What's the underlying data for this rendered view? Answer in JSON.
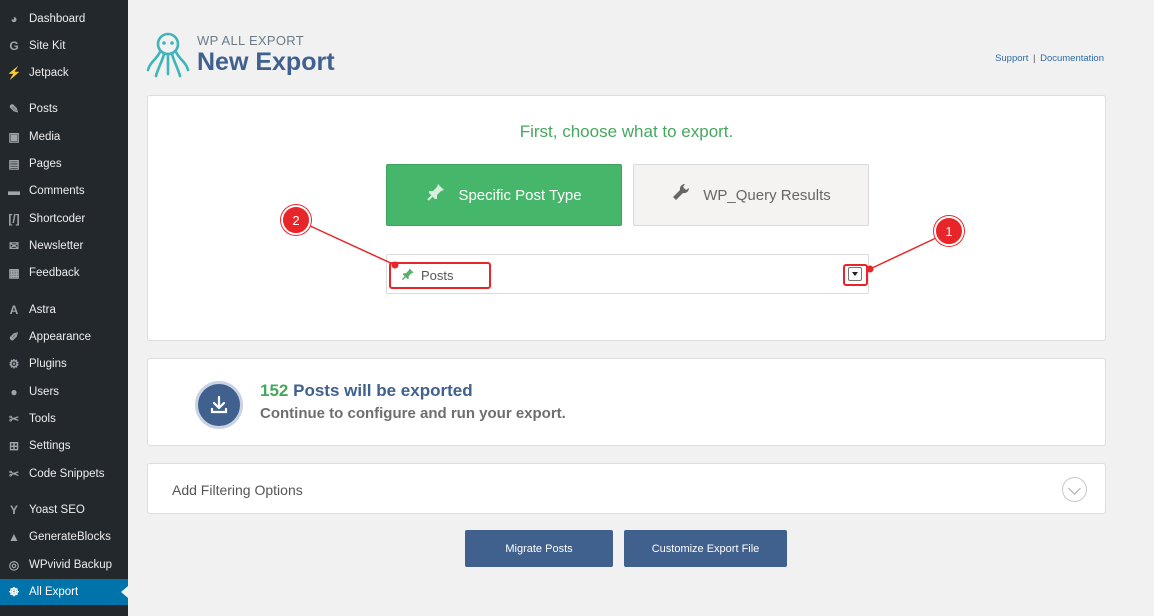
{
  "sidebar": {
    "items": [
      {
        "label": "Dashboard",
        "icon": "dashboard-icon",
        "glyph": "◕"
      },
      {
        "label": "Site Kit",
        "icon": "google-g-icon",
        "glyph": "G"
      },
      {
        "label": "Jetpack",
        "icon": "jetpack-icon",
        "glyph": "⚡"
      },
      {
        "label": "Posts",
        "icon": "pin-icon",
        "glyph": "✎"
      },
      {
        "label": "Media",
        "icon": "media-icon",
        "glyph": "▣"
      },
      {
        "label": "Pages",
        "icon": "pages-icon",
        "glyph": "▤"
      },
      {
        "label": "Comments",
        "icon": "comments-icon",
        "glyph": "▬"
      },
      {
        "label": "Shortcoder",
        "icon": "shortcode-icon",
        "glyph": "[/]"
      },
      {
        "label": "Newsletter",
        "icon": "newsletter-icon",
        "glyph": "✉"
      },
      {
        "label": "Feedback",
        "icon": "feedback-icon",
        "glyph": "▦"
      },
      {
        "label": "Astra",
        "icon": "astra-icon",
        "glyph": "A"
      },
      {
        "label": "Appearance",
        "icon": "brush-icon",
        "glyph": "✐"
      },
      {
        "label": "Plugins",
        "icon": "plugin-icon",
        "glyph": "⚙"
      },
      {
        "label": "Users",
        "icon": "users-icon",
        "glyph": "●"
      },
      {
        "label": "Tools",
        "icon": "wrench-icon",
        "glyph": "✂"
      },
      {
        "label": "Settings",
        "icon": "settings-icon",
        "glyph": "⊞"
      },
      {
        "label": "Code Snippets",
        "icon": "snippets-icon",
        "glyph": "✂"
      },
      {
        "label": "Yoast SEO",
        "icon": "yoast-icon",
        "glyph": "Y"
      },
      {
        "label": "GenerateBlocks",
        "icon": "generateblocks-icon",
        "glyph": "▲"
      },
      {
        "label": "WPvivid Backup",
        "icon": "backup-icon",
        "glyph": "◎"
      },
      {
        "label": "All Export",
        "icon": "octopus-icon",
        "glyph": "☸"
      }
    ],
    "active_item": "All Export"
  },
  "header": {
    "brand_small": "WP ALL EXPORT",
    "title": "New Export",
    "support_link": "Support",
    "separator": "|",
    "documentation_link": "Documentation"
  },
  "choose": {
    "title": "First, choose what to export.",
    "specific_post_type_label": "Specific Post Type",
    "wp_query_label": "WP_Query Results",
    "selected_post_type": "Posts"
  },
  "summary": {
    "count": "152",
    "count_text": "Posts will be exported",
    "subtitle": "Continue to configure and run your export."
  },
  "filtering": {
    "label": "Add Filtering Options"
  },
  "actions": {
    "migrate_label": "Migrate Posts",
    "customize_label": "Customize Export File"
  },
  "annotations": {
    "badge_1": "1",
    "badge_2": "2"
  },
  "colors": {
    "sidebar_bg": "#23282d",
    "sidebar_active": "#0073aa",
    "brand_blue": "#40608e",
    "green": "#46b66a",
    "annotation_red": "#e8262a"
  }
}
